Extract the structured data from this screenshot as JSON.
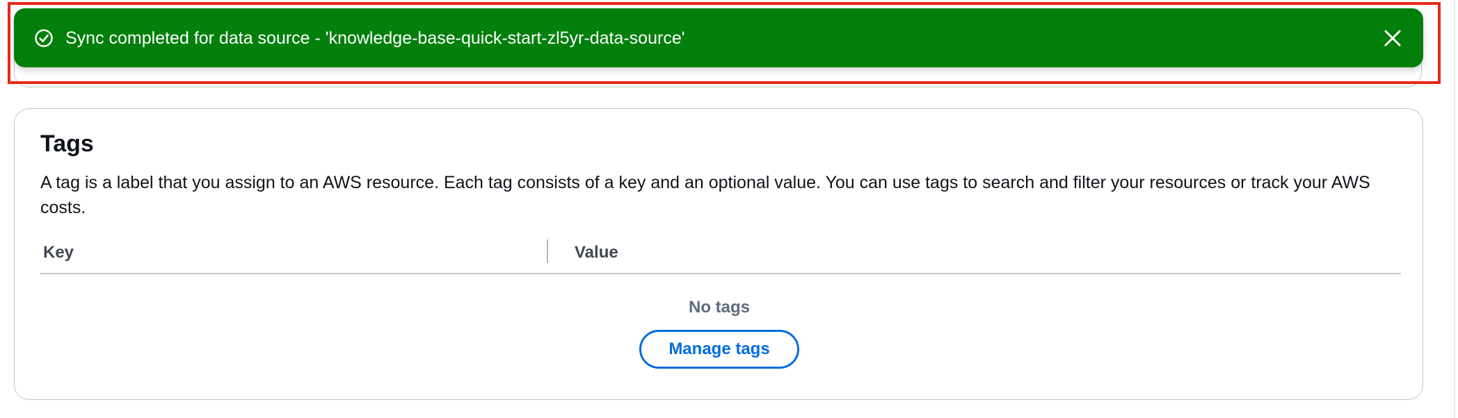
{
  "flash": {
    "type": "success",
    "icon": "check-circle-icon",
    "message": "Sync completed for data source - 'knowledge-base-quick-start-zl5yr-data-source'",
    "close_icon": "close-icon",
    "color": "#037f0c"
  },
  "tags": {
    "title": "Tags",
    "description": "A tag is a label that you assign to an AWS resource. Each tag consists of a key and an optional value. You can use tags to search and filter your resources or track your AWS costs.",
    "columns": [
      "Key",
      "Value"
    ],
    "empty_text": "No tags",
    "manage_label": "Manage tags"
  },
  "highlight_color": "#e8271b",
  "accent_color": "#006ce0"
}
